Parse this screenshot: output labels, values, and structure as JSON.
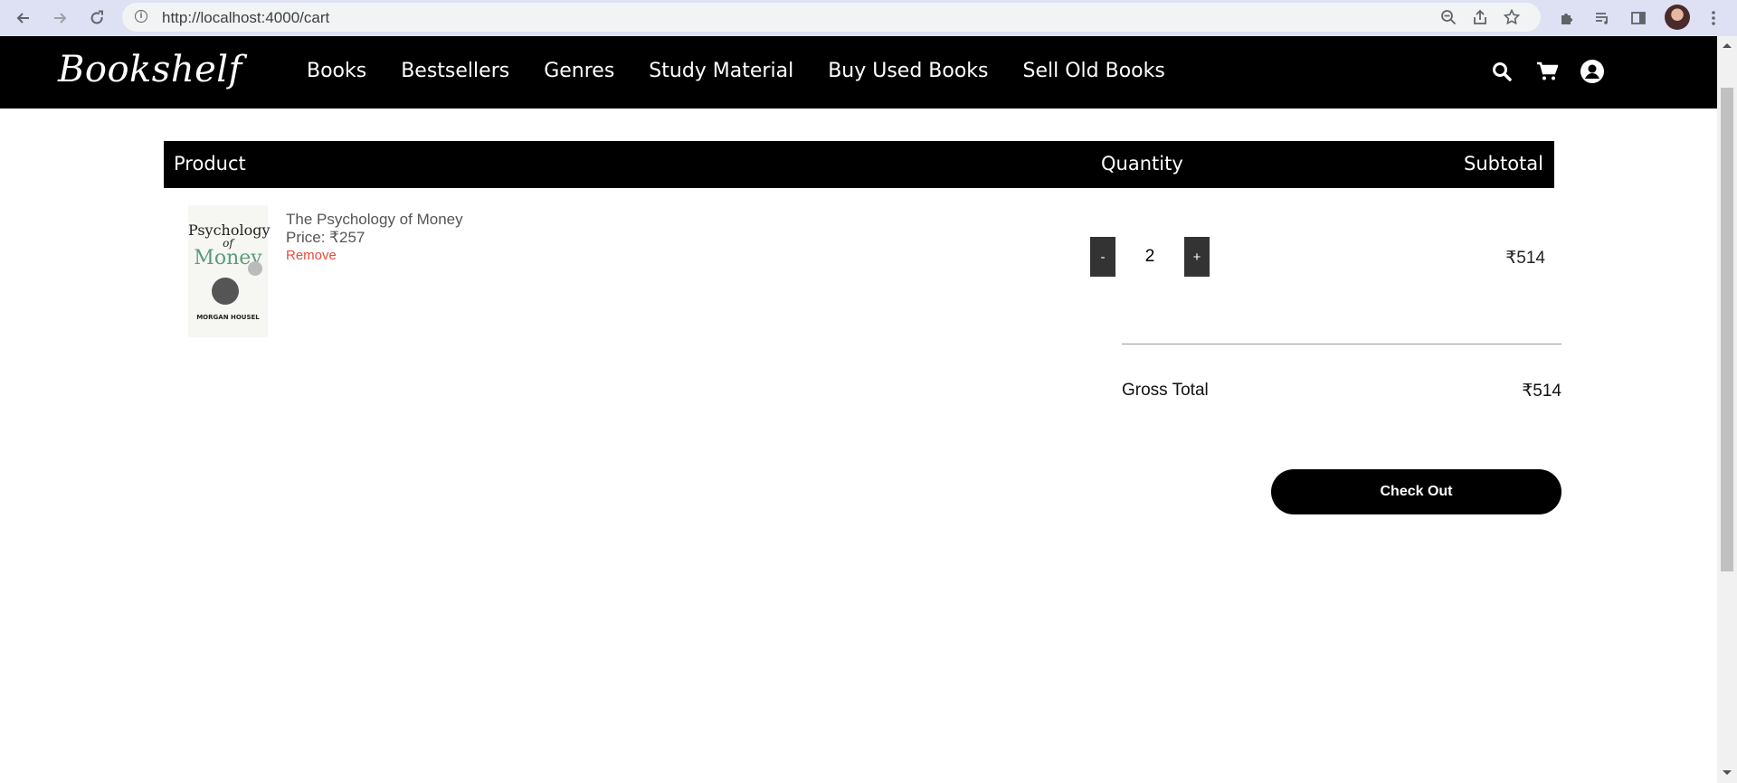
{
  "browser": {
    "url": "http://localhost:4000/cart"
  },
  "site": {
    "logo": "Bookshelf",
    "nav": [
      "Books",
      "Bestsellers",
      "Genres",
      "Study Material",
      "Buy Used Books",
      "Sell Old Books"
    ]
  },
  "cart": {
    "headers": {
      "product": "Product",
      "quantity": "Quantity",
      "subtotal": "Subtotal"
    },
    "items": [
      {
        "title": "The Psychology of Money",
        "price": "Price: ₹257",
        "remove_label": "Remove",
        "quantity": "2",
        "subtotal": "₹514",
        "cover": {
          "line1": "Psychology",
          "line2": "of",
          "line3": "Money",
          "author": "MORGAN HOUSEL"
        }
      }
    ],
    "decrement_label": "-",
    "increment_label": "+",
    "gross_total_label": "Gross Total",
    "gross_total_value": "₹514",
    "checkout_label": "Check Out"
  },
  "colors": {
    "header_bg": "#000000",
    "remove_link": "#e74c3c",
    "qty_button_bg": "#333333",
    "chrome_bg": "#dee1f3"
  }
}
